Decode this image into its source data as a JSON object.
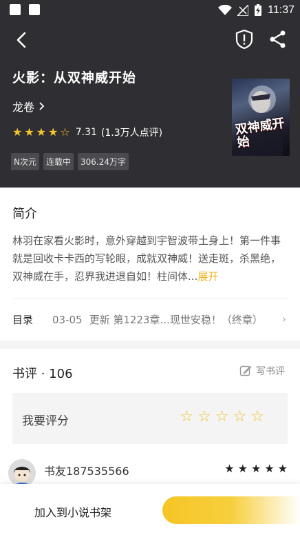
{
  "status_bar": {
    "time": "11:37"
  },
  "header": {
    "back_icon": "chevron-left-icon",
    "report_icon": "shield-alert-icon",
    "share_icon": "share-icon"
  },
  "book": {
    "title": "火影：从双神威开始",
    "author": "龙卷",
    "rating": 7.31,
    "rating_text": "7.31",
    "rating_count": "(1.3万人点评)",
    "stars_filled": 4,
    "stars_half": 1,
    "tags": [
      "N次元",
      "连载中",
      "306.24万字"
    ],
    "cover_text": "双神威开始",
    "cover_colors": {
      "accent": "#8b1a1a"
    }
  },
  "intro": {
    "heading": "简介",
    "text": "林羽在家看火影时，意外穿越到宇智波带土身上！第一件事就是回收卡卡西的写轮眼，成就双神威！送走斑，杀黑绝，双神威在手，忍界我进退自如！柱间体...",
    "expand": "展开"
  },
  "toc": {
    "label": "目录",
    "date": "03-05",
    "update": "更新  第1223章...现世安稳！（终章）",
    "arrow": "›"
  },
  "reviews": {
    "title": "书评 · 106",
    "write_label": "写书评",
    "rate_label": "我要评分",
    "rate_stars": 5,
    "first_reviewer": {
      "name": "书友187535566",
      "stars": 5
    }
  },
  "bottom_bar": {
    "add_label": "加入到小说书架"
  },
  "colors": {
    "hero_bg": "#2f2f33",
    "accent_yellow": "#f7c42c",
    "expand_link": "#f2b21b"
  }
}
